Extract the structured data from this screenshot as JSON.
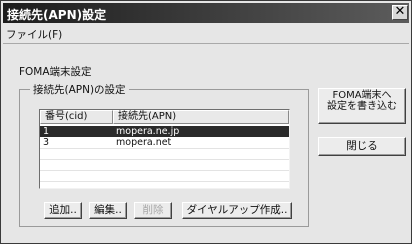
{
  "window": {
    "title": "接続先(APN)設定"
  },
  "menu": {
    "file": "ファイル(F)"
  },
  "labels": {
    "section": "FOMA端末設定",
    "group": "接続先(APN)の設定"
  },
  "table": {
    "headers": [
      "番号(cid)",
      "接続先(APN)"
    ],
    "rows": [
      {
        "cid": "1",
        "apn": "mopera.ne.jp",
        "selected": true
      },
      {
        "cid": "3",
        "apn": "mopera.net",
        "selected": false
      }
    ]
  },
  "buttons": {
    "add": "追加..",
    "edit": "編集..",
    "delete": "削除",
    "dialup": "ダイヤルアップ作成..",
    "write_line1": "FOMA端末へ",
    "write_line2": "設定を書き込む",
    "close": "閉じる"
  }
}
